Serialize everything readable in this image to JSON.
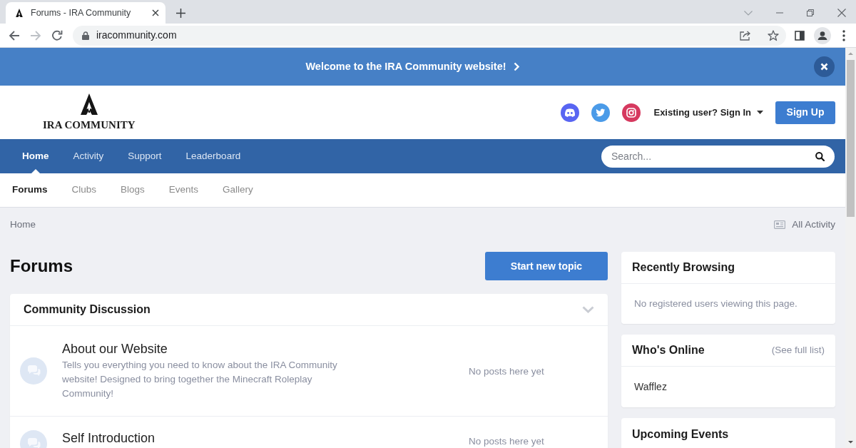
{
  "browser": {
    "tab_title": "Forums - IRA Community",
    "address": "iracommunity.com",
    "forward_disabled": true
  },
  "announcement": {
    "text": "Welcome to the IRA Community website!"
  },
  "header": {
    "logo_text": "IRA COMMUNITY",
    "sign_in": "Existing user? Sign In",
    "sign_up": "Sign Up"
  },
  "primary_nav": [
    {
      "label": "Home",
      "selected": true
    },
    {
      "label": "Activity",
      "selected": false
    },
    {
      "label": "Support",
      "selected": false
    },
    {
      "label": "Leaderboard",
      "selected": false
    }
  ],
  "search": {
    "placeholder": "Search..."
  },
  "secondary_nav": [
    {
      "label": "Forums",
      "selected": true
    },
    {
      "label": "Clubs",
      "selected": false
    },
    {
      "label": "Blogs",
      "selected": false
    },
    {
      "label": "Events",
      "selected": false
    },
    {
      "label": "Gallery",
      "selected": false
    }
  ],
  "breadcrumb": [
    "Home"
  ],
  "all_activity": "All Activity",
  "page_title": "Forums",
  "start_topic": "Start new topic",
  "category": {
    "title": "Community Discussion",
    "forums": [
      {
        "title": "About our Website",
        "description": "Tells you everything you need to know about the IRA Community website! Designed to bring together the Minecraft Roleplay Community!",
        "last_post": "No posts here yet"
      },
      {
        "title": "Self Introduction",
        "last_post": "No posts here yet"
      }
    ]
  },
  "sidebar": [
    {
      "title": "Recently Browsing",
      "text": "No registered users viewing this page."
    },
    {
      "title": "Who's Online",
      "link": "(See full list)",
      "users": [
        "Wafflez"
      ]
    },
    {
      "title": "Upcoming Events"
    }
  ]
}
